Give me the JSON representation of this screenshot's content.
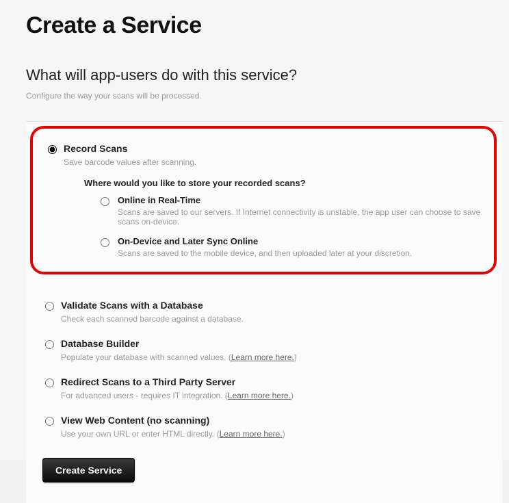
{
  "page": {
    "title": "Create a Service",
    "subheading": "What will app-users do with this service?",
    "subnote": "Configure the way your scans will be processed."
  },
  "recordScans": {
    "label": "Record Scans",
    "desc": "Save barcode values after scanning.",
    "storageQuestion": "Where would you like to store your recorded scans?",
    "online": {
      "label": "Online in Real-Time",
      "desc": "Scans are saved to our servers. If Internet connectivity is unstable, the app user can choose to save scans on-device."
    },
    "ondevice": {
      "label": "On-Device and Later Sync Online",
      "desc": "Scans are saved to the mobile device, and then uploaded later at your discretion."
    }
  },
  "validate": {
    "label": "Validate Scans with a Database",
    "desc": "Check each scanned barcode against a database."
  },
  "dbuilder": {
    "label": "Database Builder",
    "desc": "Populate your database with scanned values. (",
    "link": "Learn more here.",
    "descEnd": ")"
  },
  "redirect": {
    "label": "Redirect Scans to a Third Party Server",
    "desc": "For advanced users - requires IT integration. (",
    "link": "Learn more here.",
    "descEnd": ")"
  },
  "webcontent": {
    "label": "View Web Content (no scanning)",
    "desc": "Use your own URL or enter HTML directly. (",
    "link": "Learn more here.",
    "descEnd": ")"
  },
  "button": {
    "create": "Create Service"
  }
}
